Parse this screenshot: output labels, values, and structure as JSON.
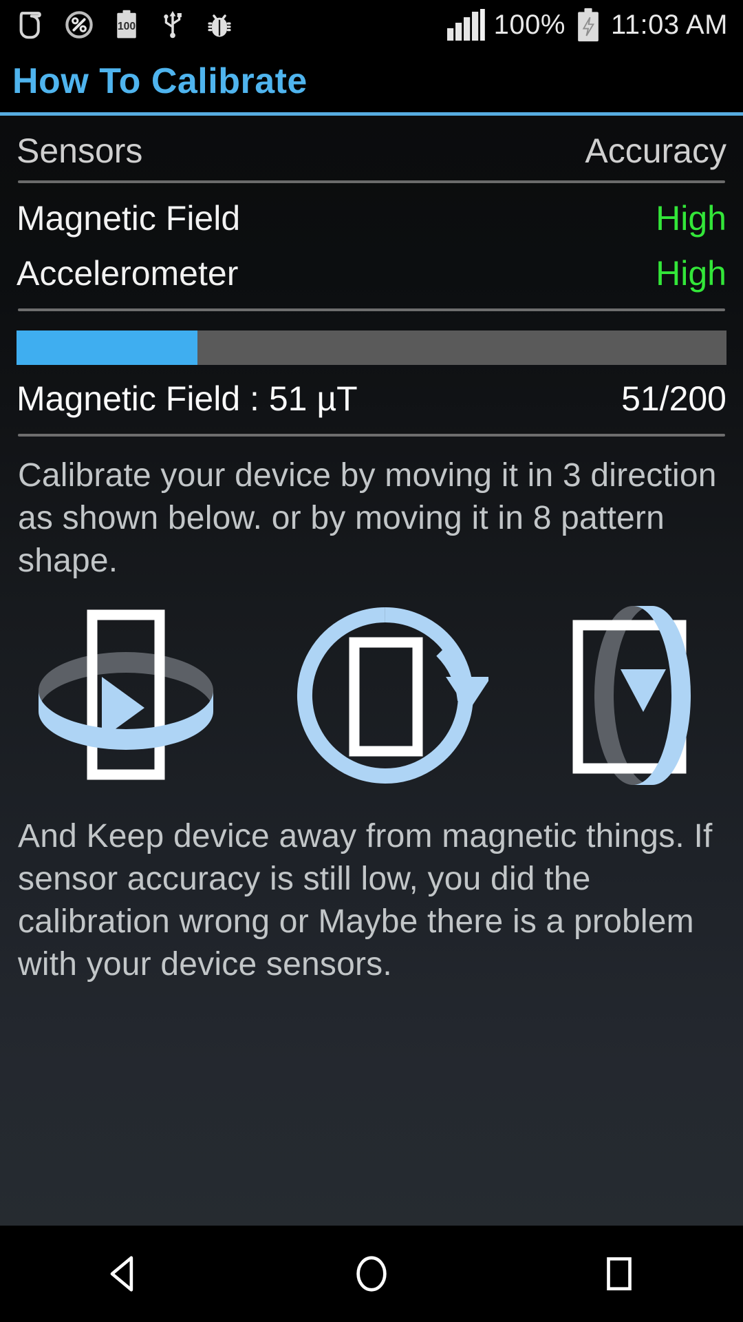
{
  "statusbar": {
    "icons_left": [
      "sigma-app-icon",
      "percent-circle-icon",
      "battery-100-icon",
      "usb-icon",
      "bug-icon"
    ],
    "signal_icon": "signal-bars-icon",
    "battery_percent": "100%",
    "battery_icon": "battery-charging-icon",
    "time": "11:03 AM"
  },
  "titlebar": {
    "title": "How To Calibrate",
    "accent_color": "#4FB4EE"
  },
  "sensor_table": {
    "col_sensors": "Sensors",
    "col_accuracy": "Accuracy",
    "rows": [
      {
        "name": "Magnetic Field",
        "accuracy": "High",
        "accuracy_color": "#33E639"
      },
      {
        "name": "Accelerometer",
        "accuracy": "High",
        "accuracy_color": "#33E639"
      }
    ]
  },
  "magnetic_reading": {
    "progress_percent": 25.5,
    "progress_fill_color": "#3FAEF0",
    "progress_track_color": "#5A5A5A",
    "label": "Magnetic Field : 51 µT",
    "ratio": "51/200"
  },
  "instructions": {
    "top": "Calibrate your device by moving it in 3 direction as shown below. or by moving it in 8 pattern shape.",
    "bottom": "And Keep device away from magnetic things. If sensor accuracy is still low, you did the calibration wrong or Maybe there is a problem with your device sensors."
  },
  "diagrams": [
    {
      "name": "rotate-horizontal-diagram",
      "ring_color": "#AED4F5",
      "shadow_color": "#5C6066"
    },
    {
      "name": "rotate-in-plane-diagram",
      "ring_color": "#AED4F5",
      "shadow_color": "#5C6066"
    },
    {
      "name": "rotate-vertical-diagram",
      "ring_color": "#AED4F5",
      "shadow_color": "#5C6066"
    }
  ],
  "navbar": {
    "back": "back-icon",
    "home": "home-icon",
    "recents": "recents-icon"
  }
}
